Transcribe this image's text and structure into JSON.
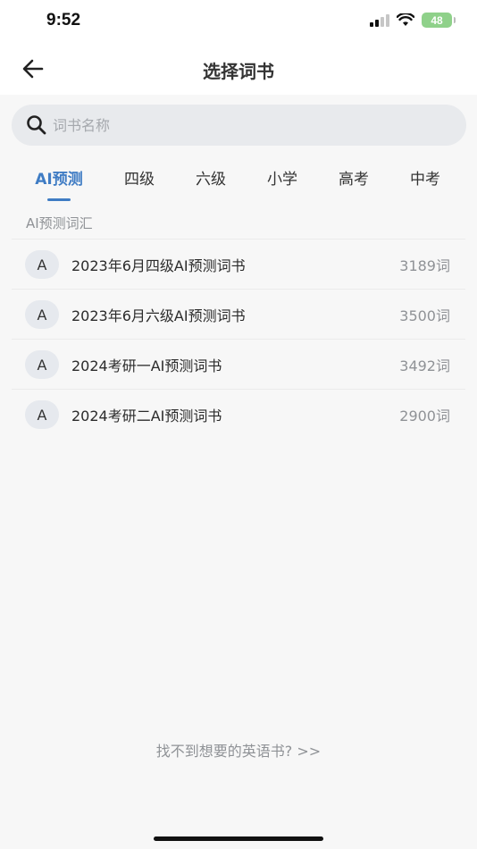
{
  "status_bar": {
    "time": "9:52",
    "battery": "48"
  },
  "header": {
    "title": "选择词书"
  },
  "search": {
    "placeholder": "词书名称"
  },
  "tabs": [
    {
      "label": "AI预测",
      "active": true
    },
    {
      "label": "四级"
    },
    {
      "label": "六级"
    },
    {
      "label": "小学"
    },
    {
      "label": "高考"
    },
    {
      "label": "中考"
    }
  ],
  "section": {
    "label": "AI预测词汇"
  },
  "books": [
    {
      "avatar": "A",
      "name": "2023年6月四级AI预测词书",
      "count": "3189词"
    },
    {
      "avatar": "A",
      "name": "2023年6月六级AI预测词书",
      "count": "3500词"
    },
    {
      "avatar": "A",
      "name": "2024考研一AI预测词书",
      "count": "3492词"
    },
    {
      "avatar": "A",
      "name": "2024考研二AI预测词书",
      "count": "2900词"
    }
  ],
  "footer": {
    "link": "找不到想要的英语书? >>"
  },
  "colors": {
    "accent": "#3f7cc4",
    "battery": "#8fd18a",
    "background": "#f7f7f7"
  }
}
